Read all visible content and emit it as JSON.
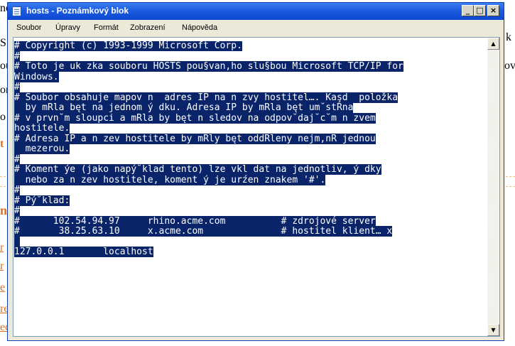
{
  "window": {
    "title": "hosts - Poznámkový blok",
    "buttons": {
      "minimize": "_",
      "maximize": "□",
      "close": "×"
    }
  },
  "menu": {
    "items": [
      "Soubor",
      "Úpravy",
      "Formát",
      "Zobrazení",
      "Nápověda"
    ]
  },
  "editor": {
    "lines": [
      "# Copyright (c) 1993-1999 Microsoft Corp.",
      "#",
      "# Toto je uk zka souboru HOSTS pou§van,ho slu§bou Microsoft TCP/IP for",
      "Windows.",
      "#",
      "# Soubor obsahuje mapov n  adres IP na n zvy hostitel…. Kaşd  položka",
      "  by mRla bęt na jednom ý dku. Adresa IP by mRla bęt um˘stRna",
      "# v prvn˘m sloupci a mRla by bęt n sledov na odpov˘daj˘c˘m n zvem",
      "hostitele.",
      "# Adresa IP a n zev hostitele by mRly bęt oddRleny nejm,nR jednou",
      "  mezerou.",
      "#",
      "# Koment ýe (jako napý˘klad tento) lze vkl dat na jednotliv, ý dky",
      "  nebo za n zev hostitele, koment ý je urźen znakem '#'.",
      "#",
      "# Pý˘klad:",
      "#",
      "#      102.54.94.97     rhino.acme.com          # zdrojové server",
      "#       38.25.63.10     x.acme.com              # hostitel klient… x",
      "",
      "127.0.0.1       localhost"
    ],
    "selected": true
  },
  "scrollbar": {
    "up": "▲",
    "down": "▼"
  },
  "background": {
    "fragments": [
      "ne",
      "k",
      "S",
      "ou",
      "ov",
      "or",
      "o",
      "t",
      "n",
      "r",
      "r",
      "e",
      "re",
      "ec"
    ]
  }
}
